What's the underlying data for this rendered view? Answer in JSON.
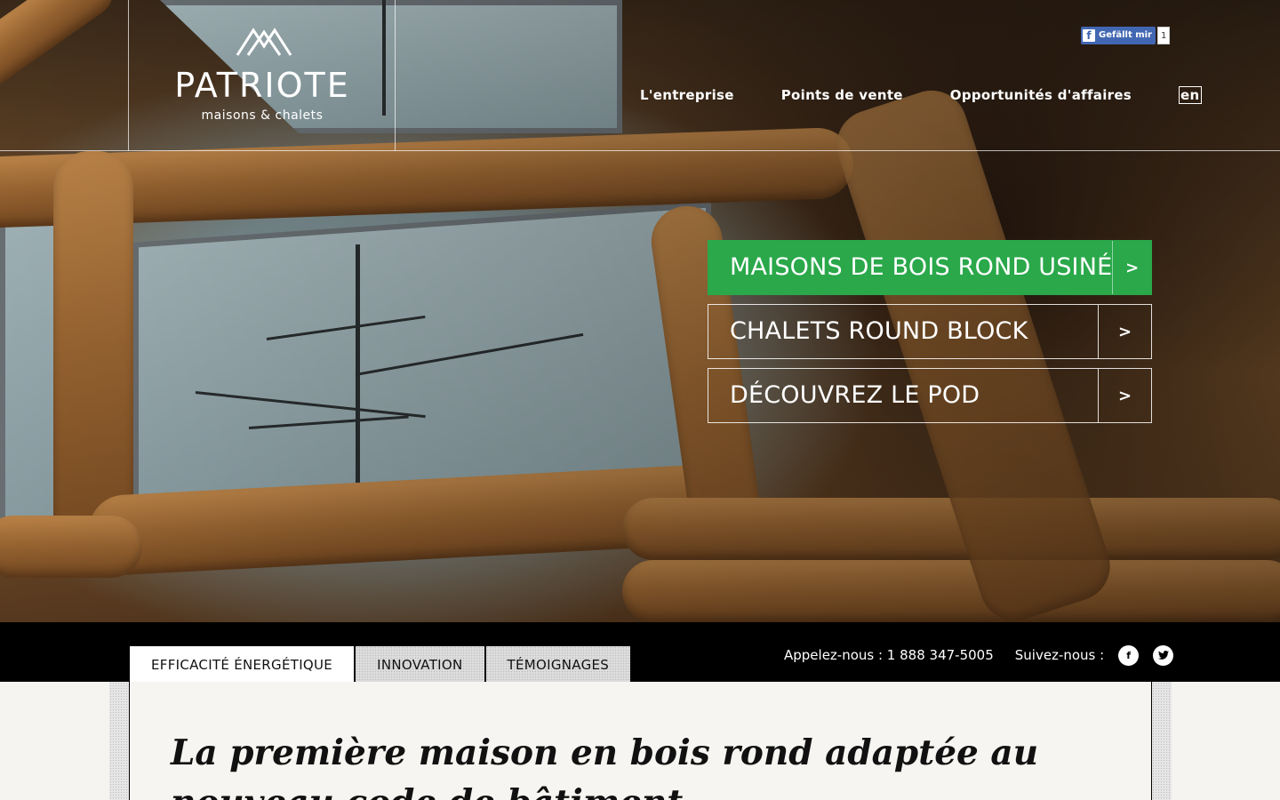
{
  "header": {
    "logo": {
      "name": "PATRIOTE",
      "tagline": "maisons & chalets"
    },
    "facebook_like": {
      "label": "Gefällt mir",
      "count": "1"
    },
    "nav": {
      "items": [
        {
          "label": "L'entreprise"
        },
        {
          "label": "Points de vente"
        },
        {
          "label": "Opportunités d'affaires"
        }
      ],
      "lang": "en"
    }
  },
  "hero": {
    "ctas": [
      {
        "label": "MAISONS DE BOIS ROND USINÉ",
        "arrow": ">"
      },
      {
        "label": "CHALETS ROUND BLOCK",
        "arrow": ">"
      },
      {
        "label": "DÉCOUVREZ LE POD",
        "arrow": ">"
      }
    ]
  },
  "bar": {
    "tabs": [
      {
        "label": "EFFICACITÉ ÉNERGÉTIQUE"
      },
      {
        "label": "INNOVATION"
      },
      {
        "label": "TÉMOIGNAGES"
      }
    ],
    "phone": "Appelez-nous : 1 888 347-5005",
    "follow": "Suivez-nous :",
    "social": {
      "facebook": "f",
      "twitter": "t"
    }
  },
  "content": {
    "headline": "La première maison en bois rond adaptée au nouveau code de bâtiment"
  },
  "colors": {
    "accent_green": "#2aa84a",
    "bar_black": "#000000",
    "facebook_blue": "#4267b2"
  }
}
